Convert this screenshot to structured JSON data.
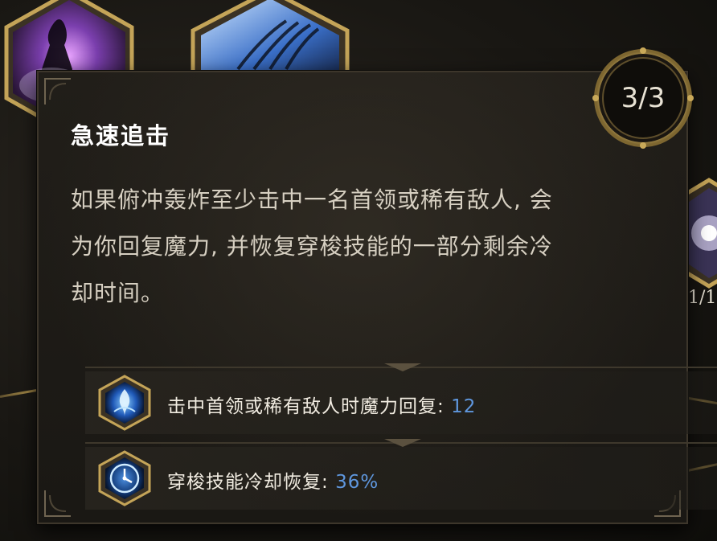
{
  "tooltip": {
    "title": "急速追击",
    "description_lines": [
      "如果俯冲轰炸至少击中一名首领或稀有敌人, 会",
      "为你回复魔力, 并恢复穿梭技能的一部分剩余冷",
      "却时间。"
    ],
    "rank": "3/3",
    "stats": [
      {
        "label": "击中首领或稀有敌人时魔力回复: ",
        "value": "12",
        "icon": "mana-flame-icon"
      },
      {
        "label": "穿梭技能冷却恢复: ",
        "value": "36%",
        "icon": "cooldown-clock-icon"
      }
    ]
  },
  "background": {
    "side_node_count": "1/1"
  },
  "colors": {
    "gold_frame": "#b8994e",
    "stat_value_blue": "#5f97de",
    "title_white": "#ffffff",
    "body_text": "#d7d0c2",
    "tooltip_bg": "#1f1c17"
  }
}
